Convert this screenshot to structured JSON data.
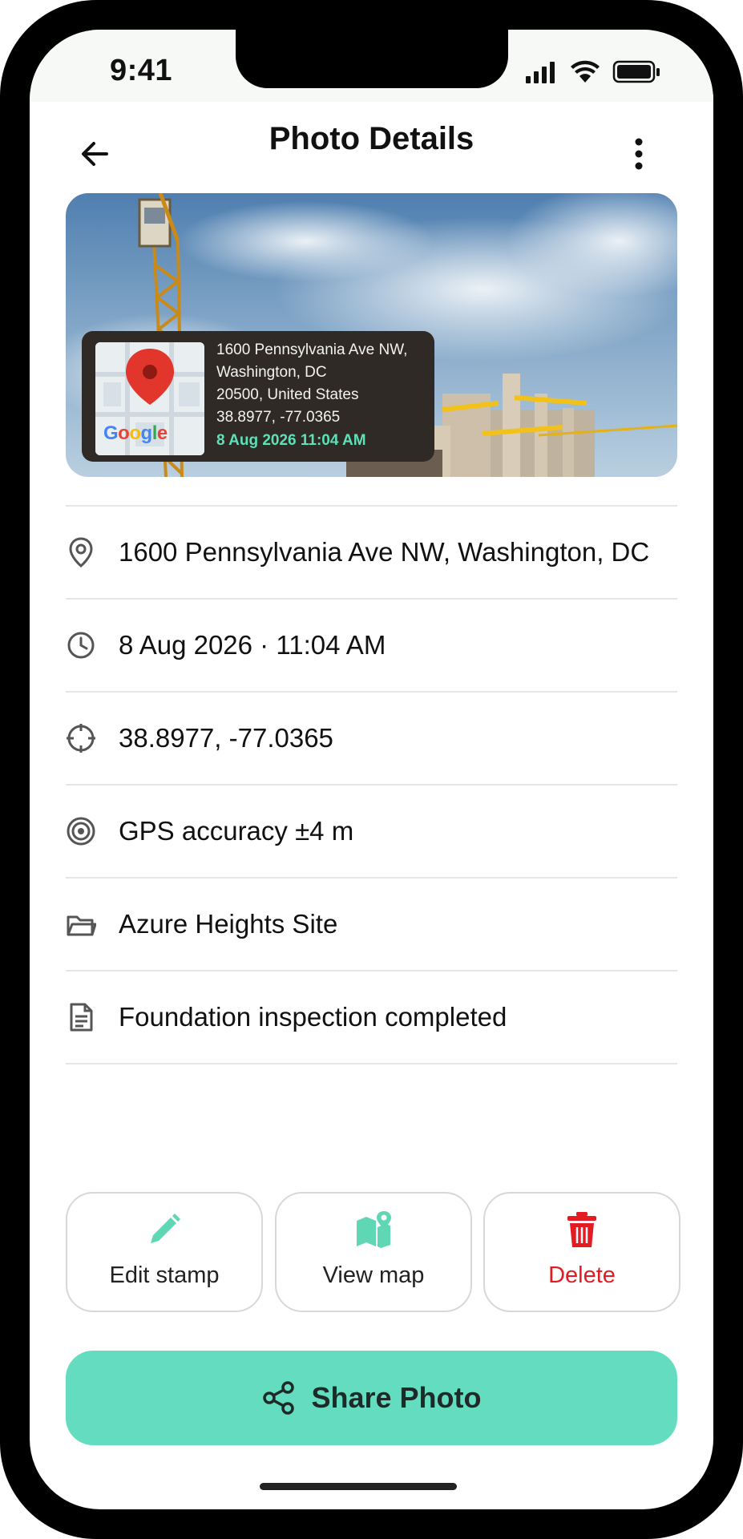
{
  "status_bar": {
    "time": "9:41"
  },
  "header": {
    "title": "Photo Details"
  },
  "photo": {
    "stamp": {
      "address_line1": "1600 Pennsylvania Ave NW,",
      "address_line2": "Washington, DC",
      "address_line3": "20500, United States",
      "coordinates": "38.8977, -77.0365",
      "datetime": "8 Aug 2026 11:04 AM",
      "map_brand": "Google"
    }
  },
  "details": {
    "address": "1600 Pennsylvania Ave NW, Washington, DC",
    "date_time": "8 Aug 2026  · 11:04 AM",
    "coordinates": "38.8977, -77.0365",
    "gps_accuracy": "GPS accuracy ±4 m",
    "project": "Azure Heights Site",
    "note": "Foundation inspection completed"
  },
  "actions": {
    "edit_label": "Edit stamp",
    "map_label": "View map",
    "delete_label": "Delete"
  },
  "share": {
    "label": "Share Photo"
  },
  "colors": {
    "accent": "#63dcc0",
    "stamp_date": "#5ee0b8",
    "delete": "#e31b23",
    "text": "#111111"
  },
  "icons": [
    "back-arrow-icon",
    "more-vertical-icon",
    "location-pin-icon",
    "clock-icon",
    "crosshair-icon",
    "target-icon",
    "folder-icon",
    "document-icon",
    "pencil-icon",
    "map-icon",
    "trash-icon",
    "share-icon"
  ]
}
